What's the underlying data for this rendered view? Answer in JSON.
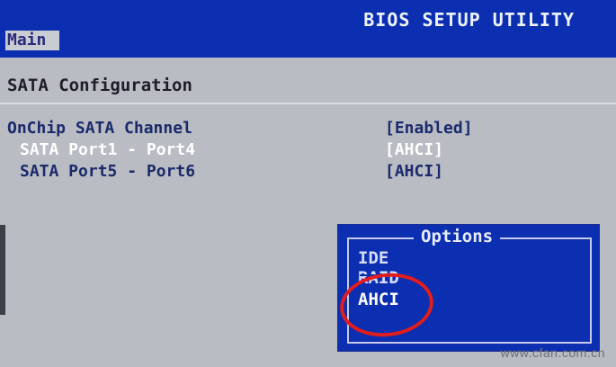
{
  "header": {
    "title": "BIOS SETUP UTILITY",
    "tab": "Main"
  },
  "section": {
    "title": "SATA Configuration"
  },
  "settings": [
    {
      "label": "OnChip SATA Channel",
      "value": "[Enabled]",
      "selected": false
    },
    {
      "label": "SATA Port1 - Port4",
      "value": "[AHCI]",
      "selected": true
    },
    {
      "label": "SATA Port5 - Port6",
      "value": "[AHCI]",
      "selected": false
    }
  ],
  "options_popup": {
    "title": "Options",
    "items": [
      "IDE",
      "RAID",
      "AHCI"
    ],
    "highlighted": "AHCI"
  },
  "watermark": "www.cfan.com.cn",
  "colors": {
    "bios_blue": "#0b2fb0",
    "panel_gray": "#b9bcc2",
    "annotation_red": "#e11d1d"
  }
}
